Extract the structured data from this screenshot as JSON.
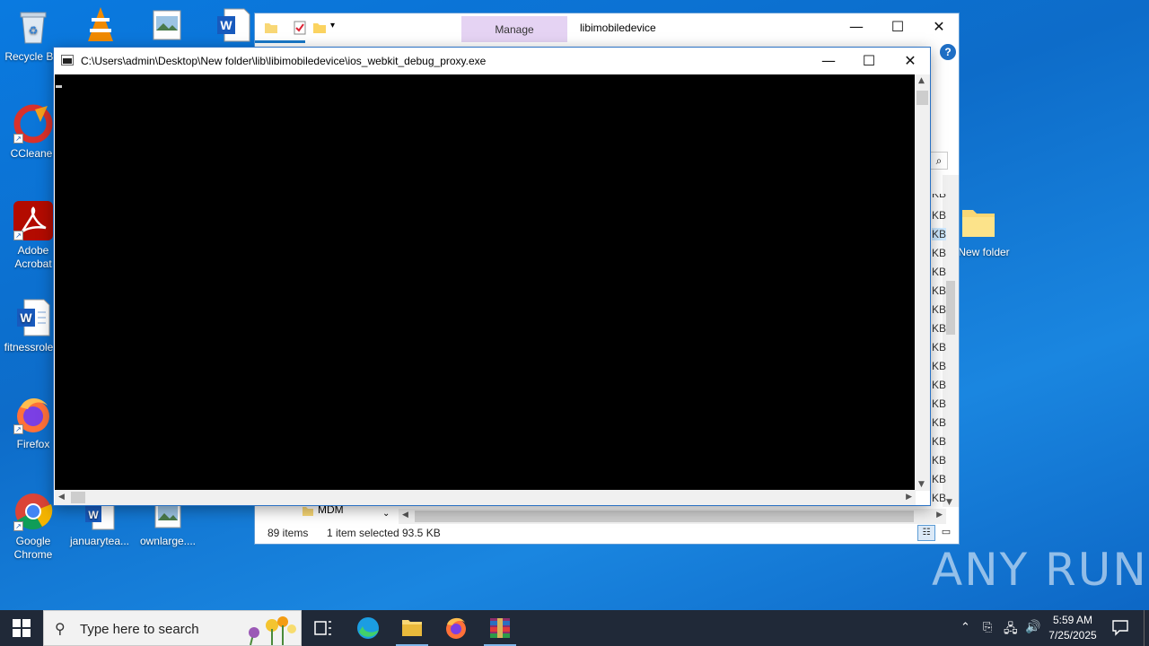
{
  "desktop": {
    "icons": [
      {
        "label": "Recycle Bin"
      },
      {
        "label": "CCleaner"
      },
      {
        "label": "Adobe Acrobat"
      },
      {
        "label": "fitnessrole..."
      },
      {
        "label": "Firefox"
      },
      {
        "label": "Google Chrome"
      },
      {
        "label": "januarytea..."
      },
      {
        "label": "ownlarge...."
      },
      {
        "label": "New folder"
      }
    ]
  },
  "explorer": {
    "manage_tab": "Manage",
    "title": "libimobiledevice",
    "nav_item": "MDM",
    "status": {
      "items": "89 items",
      "selected": "1 item selected",
      "size": "93.5 KB"
    },
    "size_unit": "KB"
  },
  "console": {
    "title": "C:\\Users\\admin\\Desktop\\New folder\\lib\\libimobiledevice\\ios_webkit_debug_proxy.exe"
  },
  "taskbar": {
    "search_placeholder": "Type here to search",
    "time": "5:59 AM",
    "date": "7/25/2025"
  },
  "watermark": "ANY RUN",
  "colors": {
    "desktop": "#0a78d7",
    "taskbar": "#202938",
    "console_bg": "#000000",
    "manage_tab": "#e5d3f3"
  }
}
